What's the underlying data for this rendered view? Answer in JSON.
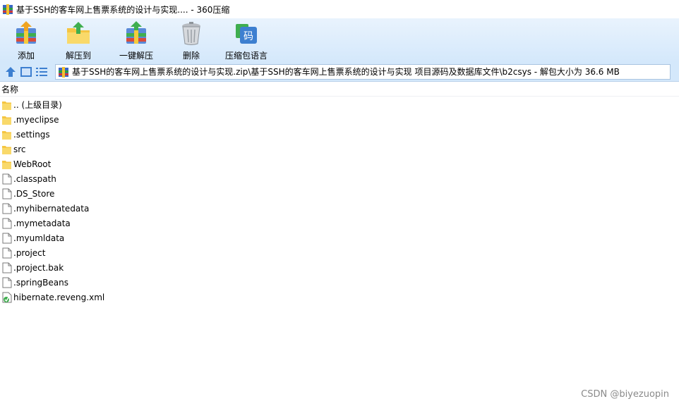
{
  "window": {
    "title": "基于SSH的客车网上售票系统的设计与实现.... - 360压缩"
  },
  "toolbar": {
    "add_label": "添加",
    "extract_to_label": "解压到",
    "one_click_extract_label": "一键解压",
    "delete_label": "删除",
    "archive_language_label": "压缩包语言",
    "archive_language_glyph": "码"
  },
  "address": {
    "path": "基于SSH的客车网上售票系统的设计与实现.zip\\基于SSH的客车网上售票系统的设计与实现 项目源码及数据库文件\\b2csys - 解包大小为 36.6 MB"
  },
  "list": {
    "column_name": "名称",
    "items": [
      {
        "name": ".. (上级目录)",
        "type": "folder"
      },
      {
        "name": ".myeclipse",
        "type": "folder"
      },
      {
        "name": ".settings",
        "type": "folder"
      },
      {
        "name": "src",
        "type": "folder"
      },
      {
        "name": "WebRoot",
        "type": "folder"
      },
      {
        "name": ".classpath",
        "type": "file"
      },
      {
        "name": ".DS_Store",
        "type": "file"
      },
      {
        "name": ".myhibernatedata",
        "type": "file"
      },
      {
        "name": ".mymetadata",
        "type": "file"
      },
      {
        "name": ".myumldata",
        "type": "file"
      },
      {
        "name": ".project",
        "type": "file"
      },
      {
        "name": ".project.bak",
        "type": "file"
      },
      {
        "name": ".springBeans",
        "type": "file"
      },
      {
        "name": "hibernate.reveng.xml",
        "type": "xml"
      }
    ]
  },
  "watermark": "CSDN @biyezuopin",
  "colors": {
    "toolbar_top": "#e9f3fd",
    "toolbar_bottom": "#d4e8fb",
    "folder": "#f7d774",
    "accent": "#3d7fd0"
  }
}
